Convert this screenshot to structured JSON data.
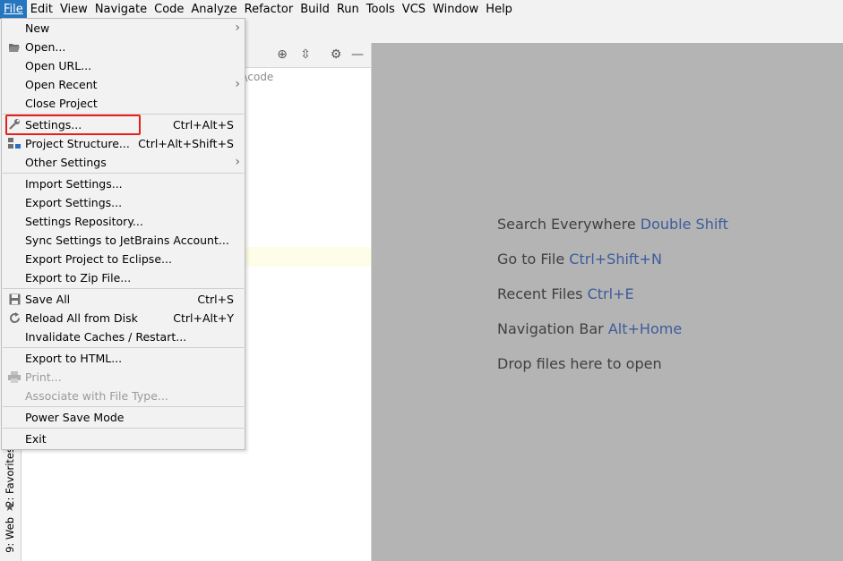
{
  "menubar": {
    "items": [
      "File",
      "Edit",
      "View",
      "Navigate",
      "Code",
      "Analyze",
      "Refactor",
      "Build",
      "Run",
      "Tools",
      "VCS",
      "Window",
      "Help"
    ]
  },
  "file_menu": {
    "items": [
      {
        "label": "New",
        "submenu": true
      },
      {
        "label": "Open...",
        "icon": "folder-open-icon"
      },
      {
        "label": "Open URL..."
      },
      {
        "label": "Open Recent",
        "submenu": true
      },
      {
        "label": "Close Project"
      },
      {
        "label": "Settings...",
        "shortcut": "Ctrl+Alt+S",
        "icon": "wrench-icon",
        "highlighted": true
      },
      {
        "label": "Project Structure...",
        "shortcut": "Ctrl+Alt+Shift+S",
        "icon": "project-structure-icon"
      },
      {
        "label": "Other Settings",
        "submenu": true
      },
      {
        "label": "Import Settings..."
      },
      {
        "label": "Export Settings..."
      },
      {
        "label": "Settings Repository..."
      },
      {
        "label": "Sync Settings to JetBrains Account..."
      },
      {
        "label": "Export Project to Eclipse..."
      },
      {
        "label": "Export to Zip File..."
      },
      {
        "label": "Save All",
        "shortcut": "Ctrl+S",
        "icon": "save-icon"
      },
      {
        "label": "Reload All from Disk",
        "shortcut": "Ctrl+Alt+Y",
        "icon": "reload-icon"
      },
      {
        "label": "Invalidate Caches / Restart..."
      },
      {
        "label": "Export to HTML..."
      },
      {
        "label": "Print...",
        "disabled": true,
        "icon": "printer-icon"
      },
      {
        "label": "Associate with File Type...",
        "disabled": true
      },
      {
        "label": "Power Save Mode"
      },
      {
        "label": "Exit"
      }
    ],
    "submenu_arrow": "›"
  },
  "project_panel": {
    "path_fragment": "l\\code"
  },
  "left_stripe": {
    "favorites_tab": "2: Favorites",
    "web_tab": "9: Web"
  },
  "editor_hints": [
    {
      "text": "Search Everywhere",
      "shortcut": "Double Shift"
    },
    {
      "text": "Go to File",
      "shortcut": "Ctrl+Shift+N"
    },
    {
      "text": "Recent Files",
      "shortcut": "Ctrl+E"
    },
    {
      "text": "Navigation Bar",
      "shortcut": "Alt+Home"
    },
    {
      "text": "Drop files here to open",
      "shortcut": ""
    }
  ],
  "colors": {
    "menu_selected": "#2675bf",
    "highlight_box": "#e8201c",
    "shortcut_text": "#3c5c9c",
    "editor_bg": "#b4b4b4"
  }
}
